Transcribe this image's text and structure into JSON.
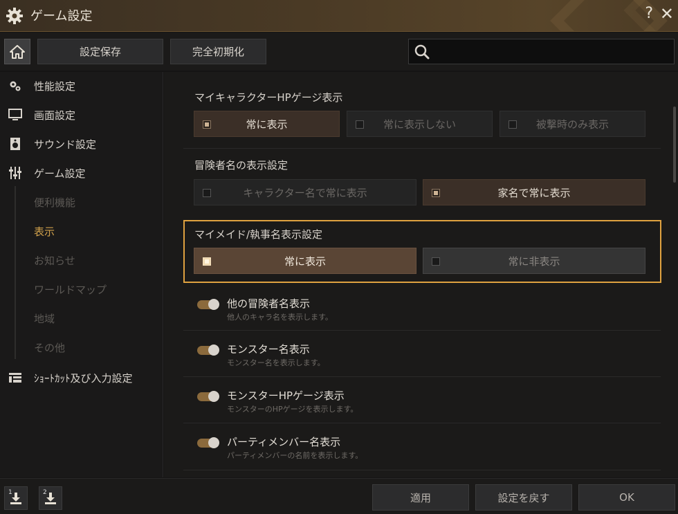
{
  "window": {
    "title": "ゲーム設定",
    "help": "?",
    "close": "✕"
  },
  "toolbar": {
    "save_label": "設定保存",
    "reset_label": "完全初期化",
    "search_placeholder": ""
  },
  "sidebar": {
    "items": [
      {
        "label": "性能設定",
        "icon": "gears-icon"
      },
      {
        "label": "画面設定",
        "icon": "monitor-icon"
      },
      {
        "label": "サウンド設定",
        "icon": "speaker-icon"
      },
      {
        "label": "ゲーム設定",
        "icon": "sliders-icon"
      }
    ],
    "sub_items": [
      {
        "label": "便利機能"
      },
      {
        "label": "表示"
      },
      {
        "label": "お知らせ"
      },
      {
        "label": "ワールドマップ"
      },
      {
        "label": "地域"
      },
      {
        "label": "その他"
      }
    ],
    "shortcut": {
      "label": "ｼｮｰﾄｶｯﾄ及び入力設定",
      "icon": "keyboard-layout-icon"
    }
  },
  "content": {
    "hp_gauge": {
      "title": "マイキャラクターHPゲージ表示",
      "options": [
        "常に表示",
        "常に表示しない",
        "被撃時のみ表示"
      ]
    },
    "adventurer_name": {
      "title": "冒険者名の表示設定",
      "options": [
        "キャラクター名で常に表示",
        "家名で常に表示"
      ]
    },
    "maid_name": {
      "title": "マイメイド/執事名表示設定",
      "options": [
        "常に表示",
        "常に非表示"
      ]
    },
    "toggles": [
      {
        "title": "他の冒険者名表示",
        "desc": "他人のキャラ名を表示します。",
        "on": true
      },
      {
        "title": "モンスター名表示",
        "desc": "モンスター名を表示します。",
        "on": true
      },
      {
        "title": "モンスターHPゲージ表示",
        "desc": "モンスターのHPゲージを表示します。",
        "on": true
      },
      {
        "title": "パーティメンバー名表示",
        "desc": "パーティメンバーの名前を表示します。",
        "on": true
      }
    ]
  },
  "bottom": {
    "download1": "1",
    "download2": "2",
    "apply": "適用",
    "revert": "設定を戻す",
    "ok": "OK"
  },
  "colors": {
    "accent": "#e0a240",
    "active_sub": "#d2a24c",
    "toggle_on": "#8b6a3c"
  }
}
